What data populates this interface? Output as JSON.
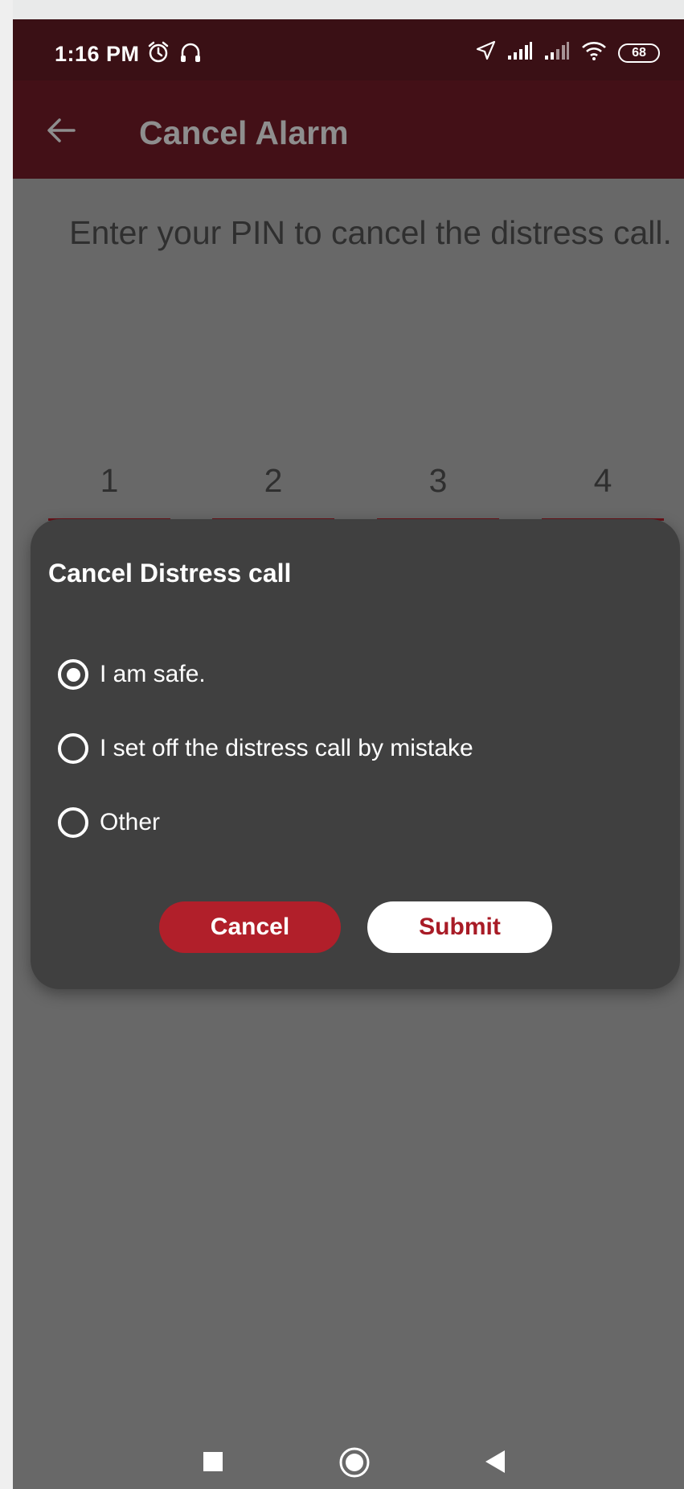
{
  "status_bar": {
    "time": "1:16 PM",
    "battery_level": "68",
    "left_icons": [
      "alarm-clock-icon",
      "headphones-icon"
    ],
    "right_icons": [
      "location-arrow-icon",
      "signal-1-icon",
      "signal-2-icon",
      "wifi-icon",
      "battery-icon"
    ]
  },
  "app_bar": {
    "title": "Cancel Alarm",
    "back_icon": "arrow-left-icon"
  },
  "main": {
    "instruction": "Enter your PIN to cancel the distress call.",
    "pin_digits": [
      "1",
      "2",
      "3",
      "4"
    ]
  },
  "dialog": {
    "title": "Cancel Distress call",
    "options": [
      {
        "label": "I am safe.",
        "selected": true
      },
      {
        "label": "I set off the distress call by mistake",
        "selected": false
      },
      {
        "label": "Other",
        "selected": false
      }
    ],
    "cancel_label": "Cancel",
    "submit_label": "Submit"
  },
  "nav_bar": {
    "icons": [
      "recents-square-icon",
      "home-circle-icon",
      "back-triangle-icon"
    ]
  },
  "colors": {
    "status_bar_bg": "#3a1015",
    "app_bar_bg": "#431017",
    "accent_red": "#b11f2a",
    "dialog_bg": "#404040",
    "scrim_bg": "#686868"
  }
}
